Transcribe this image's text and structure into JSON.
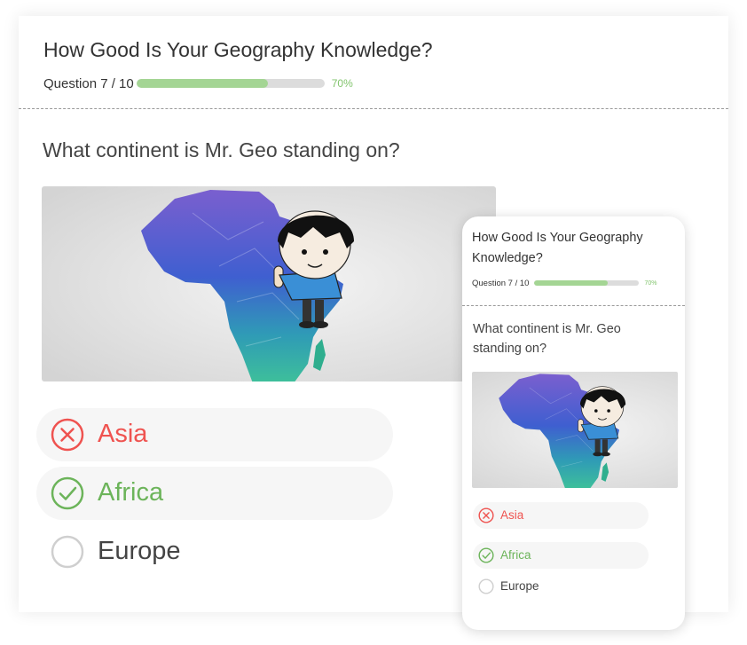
{
  "quiz": {
    "title": "How Good Is Your Geography Knowledge?",
    "question_counter": "Question 7 / 10",
    "progress": 0.7,
    "progress_label": "70%",
    "question": "What continent is Mr. Geo standing on?"
  },
  "answers": [
    {
      "label": "Asia",
      "state": "wrong",
      "icon": "x-circle-icon"
    },
    {
      "label": "Africa",
      "state": "correct",
      "icon": "check-circle-icon"
    },
    {
      "label": "Europe",
      "state": "unselected",
      "icon": "empty-circle-icon"
    }
  ],
  "colors": {
    "wrong": "#ef5350",
    "correct": "#6cb45a",
    "progress_fill": "#a4d594",
    "progress_track": "#dcdcdc"
  }
}
